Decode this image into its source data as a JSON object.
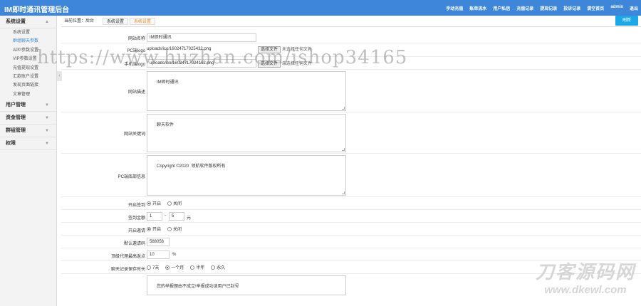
{
  "app": {
    "title": "IM即时通讯管理后台"
  },
  "topnav": [
    "手动充值",
    "账单流水",
    "用户私信",
    "充值记录",
    "提现记录",
    "投诉记录",
    "清空首页",
    "admin",
    "退出"
  ],
  "sidebar": {
    "groups": [
      {
        "label": "系统设置",
        "expanded": true,
        "items": [
          "系统设置",
          "群组聊天参数",
          "APP参数设置",
          "VIP参数设置",
          "充值提现设置",
          "汇款账户设置",
          "发现页面链接",
          "文章管理"
        ],
        "active_index": 1
      },
      {
        "label": "用户管理"
      },
      {
        "label": "资金管理"
      },
      {
        "label": "群组管理"
      },
      {
        "label": "权限"
      }
    ]
  },
  "tabbar": {
    "crumb": "当前位置：后台",
    "tabs": [
      "系统设置",
      "系统设置"
    ],
    "active_tab": 1,
    "refresh_label": "刷新"
  },
  "form": {
    "site_name": {
      "label": "网站名称",
      "value": "IM即时通讯"
    },
    "pc_logo": {
      "label": "PC端logo",
      "path": "uploads/ico/16024717025432.png",
      "button": "选择文件",
      "hint": "未选择任何文件"
    },
    "mobile_logo": {
      "label": "手机端logo",
      "path": "uploads/ico/16024717024162.png",
      "button": "选择文件",
      "hint": "未选择任何文件"
    },
    "description": {
      "label": "网站描述",
      "value": "IM即时通讯"
    },
    "keywords": {
      "label": "网站关键词",
      "value": "聊天软件"
    },
    "copyright": {
      "label": "PC端底部信息",
      "value": "Copyright ©2020  领航软件版权所有"
    },
    "signin": {
      "label": "开启签到",
      "on": "开启",
      "off": "关闭"
    },
    "signin_amount": {
      "label": "签到金额",
      "min": "1",
      "sep": "-",
      "max": "5",
      "unit": "元"
    },
    "redpacket": {
      "label": "开启邀请",
      "on": "开启",
      "off": "关闭"
    },
    "invite_code": {
      "label": "默认邀请码",
      "value": "588056"
    },
    "agent_rebate": {
      "label": "顶级代理最高返点",
      "value": "10",
      "unit": "%"
    },
    "chat_keep": {
      "label": "聊天记录保存时长",
      "options": [
        "7天",
        "一个月",
        "半年",
        "永久"
      ],
      "selected": 1
    },
    "notice": {
      "value": "您的举报理由不成立!举报成功该用户已封号"
    }
  },
  "watermark": "https://www.huzhan.com/ishop34165",
  "logo_mark": {
    "line1": "刀客源码网",
    "line2": "www.dkewl.com"
  }
}
